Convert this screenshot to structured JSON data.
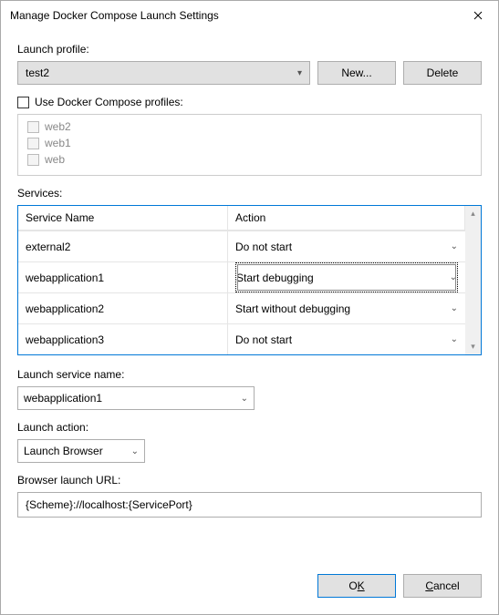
{
  "title": "Manage Docker Compose Launch Settings",
  "labels": {
    "launch_profile": "Launch profile:",
    "use_profiles": "Use Docker Compose profiles:",
    "services": "Services:",
    "launch_service_name": "Launch service name:",
    "launch_action": "Launch action:",
    "browser_url": "Browser launch URL:"
  },
  "profile_select": {
    "value": "test2"
  },
  "buttons": {
    "new": "New...",
    "delete": "Delete",
    "ok_pre": "O",
    "ok_u": "K",
    "cancel_u": "C",
    "cancel_post": "ancel"
  },
  "use_profiles_checked": false,
  "compose_profiles": [
    {
      "label": "web2"
    },
    {
      "label": "web1"
    },
    {
      "label": "web"
    }
  ],
  "services_header": {
    "name": "Service Name",
    "action": "Action"
  },
  "services_rows": [
    {
      "name": "external2",
      "action": "Do not start",
      "focused": false
    },
    {
      "name": "webapplication1",
      "action": "Start debugging",
      "focused": true
    },
    {
      "name": "webapplication2",
      "action": "Start without debugging",
      "focused": false
    },
    {
      "name": "webapplication3",
      "action": "Do not start",
      "focused": false
    }
  ],
  "launch_service_name": {
    "value": "webapplication1"
  },
  "launch_action": {
    "value": "Launch Browser"
  },
  "browser_url": {
    "value": "{Scheme}://localhost:{ServicePort}"
  }
}
